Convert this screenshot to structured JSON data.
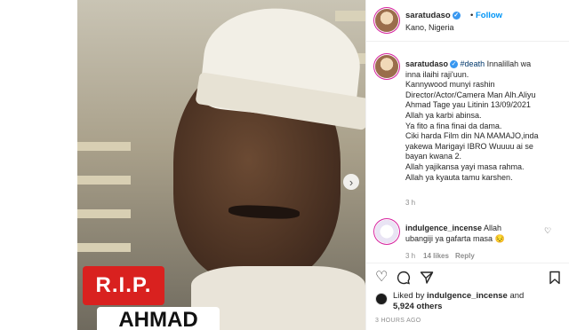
{
  "post_image": {
    "badge_rip": "R.I.P.",
    "badge_name": "AHMAD"
  },
  "header": {
    "username": "saratudaso",
    "follow_dot": "•",
    "follow_label": "Follow",
    "location": "Kano, Nigeria"
  },
  "caption": {
    "username": "saratudaso",
    "hashtag": "#death",
    "lines": [
      " Innalillah wa",
      "inna ilaihi raji'uun.",
      "Kannywood munyi rashin",
      "Director/Actor/Camera Man Alh.Aliyu",
      "Ahmad Tage yau Litinin 13/09/2021",
      "Allah ya karbi abinsa.",
      "Ya fito a fina finai da dama.",
      "Ciki harda Film din NA MAMAJO,inda",
      "yakewa Marigayi IBRO Wuuuu ai se",
      "bayan kwana 2.",
      "Allah yajikansa yayi masa rahma.",
      "Allah ya kyauta tamu karshen."
    ],
    "time": "3 h"
  },
  "comment": {
    "username": "indulgence_incense",
    "text_1": " Allah",
    "text_2": "ubangiji ya gafarta masa",
    "emoji": "😔",
    "time": "3 h",
    "likes": "14 likes",
    "reply": "Reply"
  },
  "likes": {
    "prefix": "Liked by ",
    "user": "indulgence_incense",
    "middle": " and",
    "count": "5,924 others"
  },
  "timestamp": "3 HOURS AGO",
  "icons": [
    "verified-icon",
    "heart-icon",
    "comment-icon",
    "share-icon",
    "bookmark-icon",
    "next-arrow-icon"
  ]
}
